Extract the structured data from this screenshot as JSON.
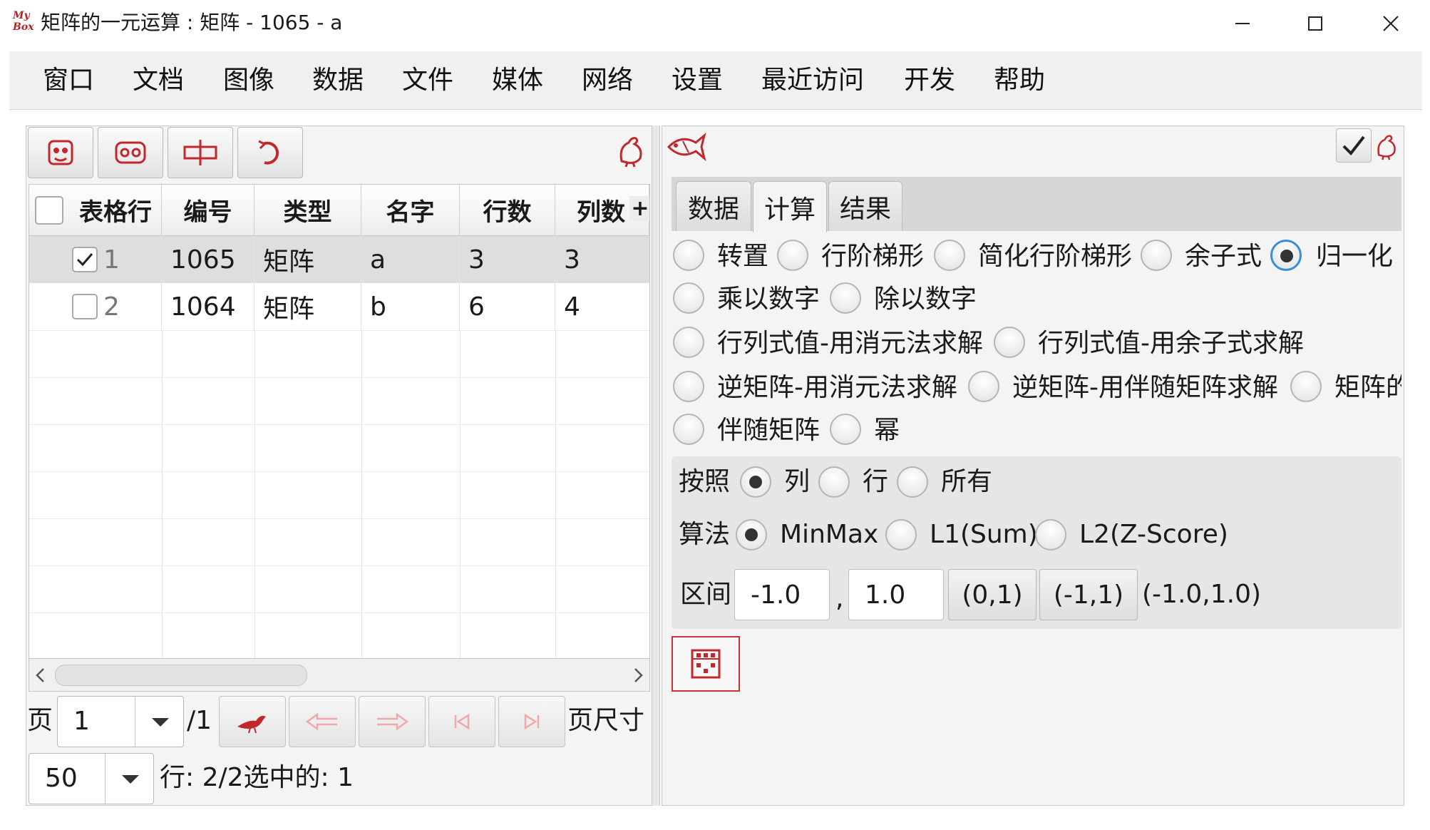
{
  "window": {
    "logo": "My Box",
    "title": "矩阵的一元运算 : 矩阵 - 1065 - a"
  },
  "menu": [
    "窗口",
    "文档",
    "图像",
    "数据",
    "文件",
    "媒体",
    "网络",
    "设置",
    "最近访问",
    "开发",
    "帮助"
  ],
  "table": {
    "columns": [
      "表格行",
      "编号",
      "类型",
      "名字",
      "行数",
      "列数"
    ],
    "add_column_glyph": "+",
    "rows": [
      {
        "row": "1",
        "checked": true,
        "id": "1065",
        "type": "矩阵",
        "name": "a",
        "rows": "3",
        "cols": "3"
      },
      {
        "row": "2",
        "checked": false,
        "id": "1064",
        "type": "矩阵",
        "name": "b",
        "rows": "6",
        "cols": "4"
      }
    ]
  },
  "pagination": {
    "page_label": "页",
    "page_value": "1",
    "page_total": "/1",
    "page_size_label": "页尺寸",
    "page_size_value": "50",
    "status": "行: 2/2选中的: 1"
  },
  "tabs": [
    "数据",
    "计算",
    "结果"
  ],
  "active_tab": "计算",
  "operations": {
    "row1": [
      "转置",
      "行阶梯形",
      "简化行阶梯形",
      "余子式",
      "归一化"
    ],
    "row2": [
      "乘以数字",
      "除以数字"
    ],
    "row3": [
      "行列式值-用消元法求解",
      "行列式值-用余子式求解"
    ],
    "row4": [
      "逆矩阵-用消元法求解",
      "逆矩阵-用伴随矩阵求解",
      "矩阵的"
    ],
    "row5": [
      "伴随矩阵",
      "幂"
    ],
    "selected": "归一化"
  },
  "normalize": {
    "by_label": "按照",
    "by_options": [
      "列",
      "行",
      "所有"
    ],
    "by_selected": "列",
    "algo_label": "算法",
    "algo_options": [
      "MinMax",
      "L1(Sum)",
      "L2(Z-Score)"
    ],
    "algo_selected": "MinMax",
    "range_label": "区间",
    "range_from": "-1.0",
    "range_sep": ",",
    "range_to": "1.0",
    "preset1": "(0,1)",
    "preset2": "(-1,1)",
    "range_display": "(-1.0,1.0)"
  },
  "colors": {
    "accent_red": "#c0282d",
    "focus_blue": "#3b8ed8",
    "panel_bg": "#f4f4f4"
  }
}
